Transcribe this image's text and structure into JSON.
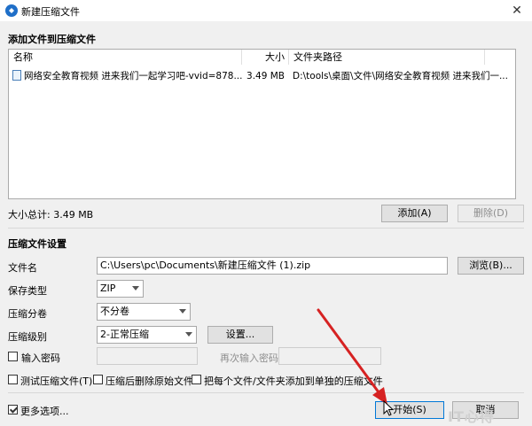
{
  "window": {
    "title": "新建压缩文件",
    "close_glyph": "✕"
  },
  "add_section": {
    "title": "添加文件到压缩文件",
    "columns": [
      "名称",
      "大小",
      "文件夹路径"
    ],
    "files": [
      {
        "name": "网络安全教育视频 进来我们一起学习吧-vvid=878...",
        "size": "3.49 MB",
        "path": "D:\\tools\\桌面\\文件\\网络安全教育视频 进来我们一..."
      }
    ],
    "total_label": "大小总计: 3.49 MB",
    "add_button": "添加(A)",
    "delete_button": "删除(D)"
  },
  "settings": {
    "title": "压缩文件设置",
    "filename_label": "文件名",
    "filename_value": "C:\\Users\\pc\\Documents\\新建压缩文件 (1).zip",
    "browse_button": "浏览(B)...",
    "save_type_label": "保存类型",
    "save_type_value": "ZIP",
    "split_label": "压缩分卷",
    "split_value": "不分卷",
    "level_label": "压缩级别",
    "level_value": "2-正常压缩",
    "settings_button": "设置...",
    "password_label": "输入密码",
    "reenter_label": "再次输入密码",
    "test_label": "测试压缩文件(T)",
    "delete_after_label": "压缩后删除原始文件",
    "separate_label": "把每个文件/文件夹添加到单独的压缩文件"
  },
  "footer": {
    "more_options_label": "更多选项...",
    "start_button": "开始(S)",
    "cancel_button": "取消"
  },
  "watermark": "IT心得",
  "colors": {
    "accent": "#0078d7",
    "arrow": "#d62222"
  }
}
